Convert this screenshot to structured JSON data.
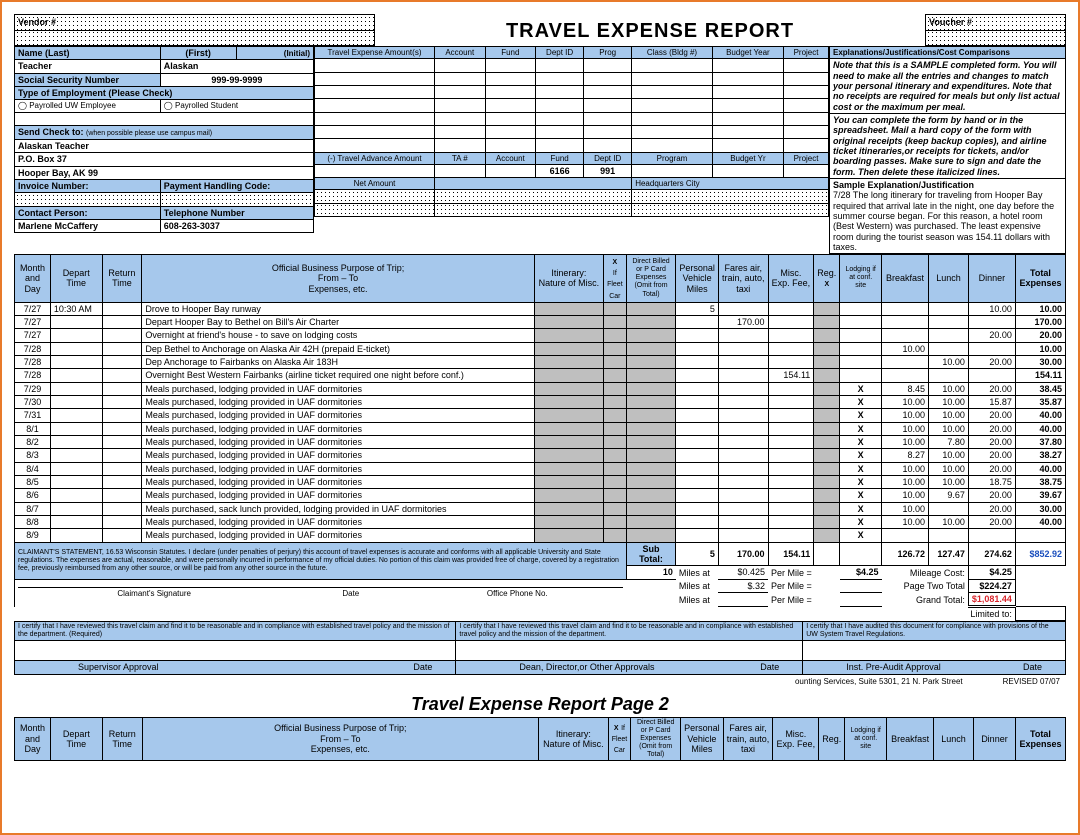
{
  "header": {
    "title": "TRAVEL  EXPENSE  REPORT",
    "vendor_lbl": "Vendor #",
    "voucher_lbl": "Voucher #"
  },
  "name": {
    "last_lbl": "Name (Last)",
    "last": "Teacher",
    "first_lbl": "(First)",
    "first": "Alaskan",
    "init_lbl": "(Initial)"
  },
  "ssn": {
    "lbl": "Social Security Number",
    "val": "999-99-9999"
  },
  "emp": {
    "lbl": "Type of Employment (Please Check)",
    "opt1": "Payrolled UW Employee",
    "opt2": "Payrolled Student"
  },
  "send": {
    "lbl": "Send Check to:",
    "hint": "(when possible please use campus mail)",
    "l1": "Alaskan Teacher",
    "l2": "P.O. Box 37",
    "l3": "Hooper Bay, AK  99"
  },
  "inv": {
    "num_lbl": "Invoice Number:",
    "pay_lbl": "Payment Handling Code:"
  },
  "contact": {
    "lbl": "Contact Person:",
    "name": "Marlene McCaffery",
    "tel_lbl": "Telephone Number",
    "tel": "608-263-3037"
  },
  "exp_amt_lbl": "Travel Expense Amount(s)",
  "adv": {
    "lbl": "(-) Travel Advance Amount",
    "fund": "6166",
    "dept": "991"
  },
  "net_lbl": "Net Amount",
  "hq_lbl": "Headquarters City",
  "colhdr": {
    "ta": "TA #",
    "acct": "Account",
    "fund": "Fund",
    "dept": "Dept ID",
    "prog": "Prog",
    "class": "Class (Bldg #)",
    "by": "Budget Year",
    "proj": "Project",
    "program": "Program",
    "byr": "Budget Yr"
  },
  "explain_hdr": "Explanations/Justifications/Cost Comparisons",
  "sample_txt": "Note that this is a SAMPLE completed form.  You will need to make all the entries and changes to match your personal itinerary and expenditures.  Note that no receipts are required for meals but only list actual cost or the maximum per meal.",
  "instr_txt": "You can complete the form by hand or in the spreadsheet.  Mail a hard copy of the form with original receipts (keep backup copies), and airline ticket itineraries,or receipts for tickets, and/or boarding passes.  Make sure to sign and date the form.  Then delete these italicized lines.",
  "samp_lbl": "Sample Explanation/Justification",
  "samp_txt": "7/28  The long itinerary for traveling from Hooper Bay required that arrival late in the night, one day before the summer course began.  For this reason, a hotel room (Best Western) was purchased.  The least expensive room during the tourist season was 154.11 dollars with taxes.",
  "grid_hdr": {
    "day": "Month and Day",
    "dep": "Depart Time",
    "ret": "Return Time",
    "purpose": "Official Business Purpose of Trip;\nFrom – To\nExpenses, etc.",
    "itin": "Itinerary:\nNature of Misc.",
    "fleet": "If Fleet Car",
    "card": "Direct Billed or  P Card   Expenses (Omit from Total)",
    "pv": "Personal Vehicle Miles",
    "fares": "Fares air, train, auto, taxi",
    "misc": "Misc. Exp. Fee,",
    "reg": "Reg.",
    "lodge": "Lodging if at conf. site",
    "bfast": "Breakfast",
    "lunch": "Lunch",
    "dinner": "Dinner",
    "total": "Total Expenses"
  },
  "rows": [
    {
      "d": "7/27",
      "dep": "10:30 AM",
      "p": "Drove to Hooper Bay runway",
      "pv": "5",
      "tot": "10.00",
      "dn": "10.00"
    },
    {
      "d": "7/27",
      "p": "Depart Hooper Bay to Bethel on Bill's Air Charter",
      "fares": "170.00",
      "tot": "170.00"
    },
    {
      "d": "7/27",
      "p": "Overnight at friend's house - to save on lodging costs",
      "dn": "20.00",
      "tot": "20.00"
    },
    {
      "d": "7/28",
      "p": "Dep Bethel to Anchorage on Alaska Air 42H (prepaid E-ticket)",
      "bf": "10.00",
      "tot": "10.00"
    },
    {
      "d": "7/28",
      "p": "Dep Anchorage to Fairbanks on Alaska Air 183H",
      "ln": "10.00",
      "dn": "20.00",
      "tot": "30.00"
    },
    {
      "d": "7/28",
      "p": "Overnight  Best Western Fairbanks (airline ticket required one night before conf.)",
      "misc": "154.11",
      "tot": "154.11"
    },
    {
      "d": "7/29",
      "p": "Meals purchased, lodging provided in UAF dormitories",
      "x": "1",
      "bf": "8.45",
      "ln": "10.00",
      "dn": "20.00",
      "tot": "38.45"
    },
    {
      "d": "7/30",
      "p": "Meals purchased, lodging provided in UAF dormitories",
      "x": "1",
      "bf": "10.00",
      "ln": "10.00",
      "dn": "15.87",
      "tot": "35.87"
    },
    {
      "d": "7/31",
      "p": "Meals purchased, lodging provided in UAF dormitories",
      "x": "1",
      "bf": "10.00",
      "ln": "10.00",
      "dn": "20.00",
      "tot": "40.00"
    },
    {
      "d": "8/1",
      "p": "Meals purchased, lodging provided in UAF dormitories",
      "x": "1",
      "bf": "10.00",
      "ln": "10.00",
      "dn": "20.00",
      "tot": "40.00"
    },
    {
      "d": "8/2",
      "p": "Meals purchased, lodging provided in UAF dormitories",
      "x": "1",
      "bf": "10.00",
      "ln": "7.80",
      "dn": "20.00",
      "tot": "37.80"
    },
    {
      "d": "8/3",
      "p": "Meals purchased, lodging provided in UAF dormitories",
      "x": "1",
      "bf": "8.27",
      "ln": "10.00",
      "dn": "20.00",
      "tot": "38.27"
    },
    {
      "d": "8/4",
      "p": "Meals purchased, lodging provided in UAF dormitories",
      "x": "1",
      "bf": "10.00",
      "ln": "10.00",
      "dn": "20.00",
      "tot": "40.00"
    },
    {
      "d": "8/5",
      "p": "Meals purchased, lodging provided in UAF dormitories",
      "x": "1",
      "bf": "10.00",
      "ln": "10.00",
      "dn": "18.75",
      "tot": "38.75"
    },
    {
      "d": "8/6",
      "p": "Meals purchased, lodging provided in UAF dormitories",
      "x": "1",
      "bf": "10.00",
      "ln": "9.67",
      "dn": "20.00",
      "tot": "39.67"
    },
    {
      "d": "8/7",
      "p": "Meals purchased, sack lunch provided, lodging provided in UAF dormitories",
      "x": "1",
      "bf": "10.00",
      "dn": "20.00",
      "tot": "30.00"
    },
    {
      "d": "8/8",
      "p": "Meals purchased, lodging provided in UAF dormitories",
      "x": "1",
      "bf": "10.00",
      "ln": "10.00",
      "dn": "20.00",
      "tot": "40.00"
    },
    {
      "d": "8/9",
      "p": "Meals purchased, lodging provided in UAF dormitories",
      "x": "1"
    }
  ],
  "claim": "CLAIMANT'S STATEMENT, 16.53 Wisconsin Statutes. I declare (under penalties of perjury) this account of travel expenses is accurate and conforms with all applicable University and State regulations. The expenses are actual, reasonable, and were personally incurred in performance of my official duties. No portion of this claim was provided free of charge, covered by a registration fee, previously reimbursed from any other source, or will be paid from any other source in the future.",
  "subtotal": {
    "lbl": "Sub Total:",
    "pv": "5",
    "fares": "170.00",
    "misc": "154.11",
    "bf": "126.72",
    "ln": "127.47",
    "dn": "274.62",
    "tot": "$852.92"
  },
  "mileage": {
    "miles": "10",
    "m_lbl": "Miles at",
    "r1": "$0.425",
    "r2": "$.32",
    "pm": "Per Mile =",
    "pm_v": "$4.25",
    "cost_lbl": "Mileage Cost:",
    "cost": "$4.25",
    "p2_lbl": "Page Two Total",
    "p2": "$224.27",
    "gt_lbl": "Grand Total:",
    "gt": "$1,081.44",
    "lim": "Limited to:"
  },
  "sigs": {
    "claim": "Claimant's Signature",
    "date": "Date",
    "phone": "Office Phone No.",
    "sup": "Supervisor Approval",
    "dean": "Dean, Director,or Other Approvals",
    "audit": "Inst. Pre-Audit Approval"
  },
  "cert1": "I certify that I have reviewed this travel claim and find it to be reasonable and in compliance with established travel policy and the mission of the department. (Required)",
  "cert2": "I certify that I have reviewed this travel claim and find it to be reasonable and in compliance with established travel policy and the mission of the department.",
  "cert3": "I certify that I have audited this document for compliance with provisions of the UW System Travel Regulations.",
  "footer": {
    "addr": "ounting Services, Suite 5301, 21 N. Park Street",
    "rev": "REVISED 07/07"
  },
  "p2": {
    "title": "Travel Expense Report Page 2"
  }
}
